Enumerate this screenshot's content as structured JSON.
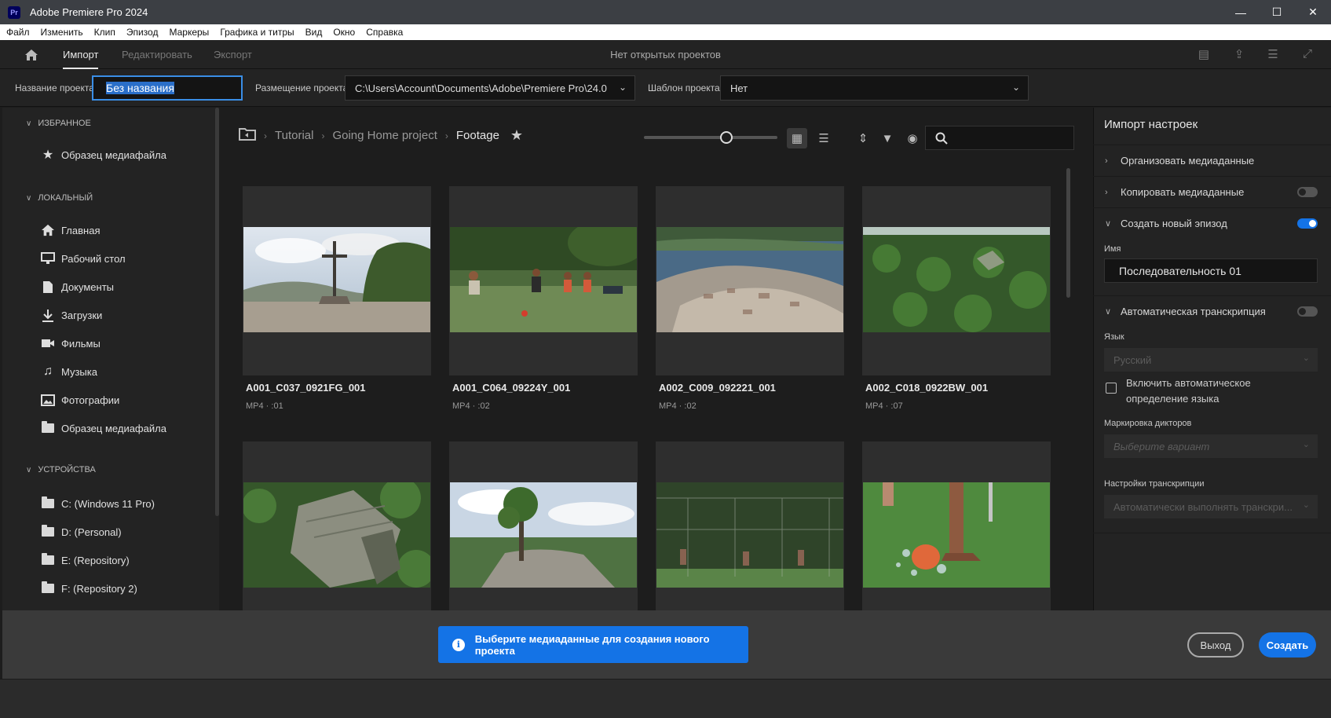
{
  "window": {
    "title": "Adobe Premiere Pro 2024",
    "app_badge": "Pr",
    "minimize": "—",
    "maximize": "☐",
    "close": "✕"
  },
  "menu": [
    "Файл",
    "Изменить",
    "Клип",
    "Эпизод",
    "Маркеры",
    "Графика и титры",
    "Вид",
    "Окно",
    "Справка"
  ],
  "header": {
    "tabs": [
      "Импорт",
      "Редактировать",
      "Экспорт"
    ],
    "active_tab": "Импорт",
    "center_text": "Нет открытых проектов"
  },
  "project": {
    "name_label": "Название проекта",
    "name_value": "Без названия",
    "location_label": "Размещение проекта",
    "location_value": "C:\\Users\\Account\\Documents\\Adobe\\Premiere Pro\\24.0",
    "template_label": "Шаблон проекта",
    "template_value": "Нет"
  },
  "sidebar": {
    "favorites": {
      "title": "ИЗБРАННОЕ",
      "items": [
        "Образец медиафайла"
      ]
    },
    "local": {
      "title": "ЛОКАЛЬНЫЙ",
      "items": [
        "Главная",
        "Рабочий стол",
        "Документы",
        "Загрузки",
        "Фильмы",
        "Музыка",
        "Фотографии",
        "Образец медиафайла"
      ]
    },
    "devices": {
      "title": "УСТРОЙСТВА",
      "items": [
        "C: (Windows 11 Pro)",
        "D: (Personal)",
        "E: (Repository)",
        "F: (Repository 2)"
      ]
    }
  },
  "breadcrumb": [
    "Tutorial",
    "Going Home project",
    "Footage"
  ],
  "media": [
    {
      "name": "A001_C037_0921FG_001",
      "meta": "MP4 · :01"
    },
    {
      "name": "A001_C064_09224Y_001",
      "meta": "MP4 · :02"
    },
    {
      "name": "A002_C009_092221_001",
      "meta": "MP4 · :02"
    },
    {
      "name": "A002_C018_0922BW_001",
      "meta": "MP4 · :07"
    }
  ],
  "import_settings": {
    "title": "Импорт настроек",
    "organize": "Организовать медиаданные",
    "copy": "Копировать медиаданные",
    "copy_on": false,
    "new_sequence": "Создать новый эпизод",
    "new_sequence_on": true,
    "name_label": "Имя",
    "name_value": "Последовательность 01",
    "auto_transcription": "Автоматическая транскрипция",
    "auto_transcription_on": false,
    "language_label": "Язык",
    "language_value": "Русский",
    "auto_detect_label": "Включить автоматическое определение языка",
    "speaker_label": "Маркировка дикторов",
    "speaker_placeholder": "Выберите вариант",
    "transcription_settings_label": "Настройки транскрипции",
    "transcription_settings_value": "Автоматически выполнять транскри..."
  },
  "footer": {
    "toast": "Выберите медиаданные для создания нового проекта",
    "exit": "Выход",
    "create": "Создать"
  },
  "colors": {
    "accent": "#1473e6",
    "selection": "#2a6fc9"
  }
}
